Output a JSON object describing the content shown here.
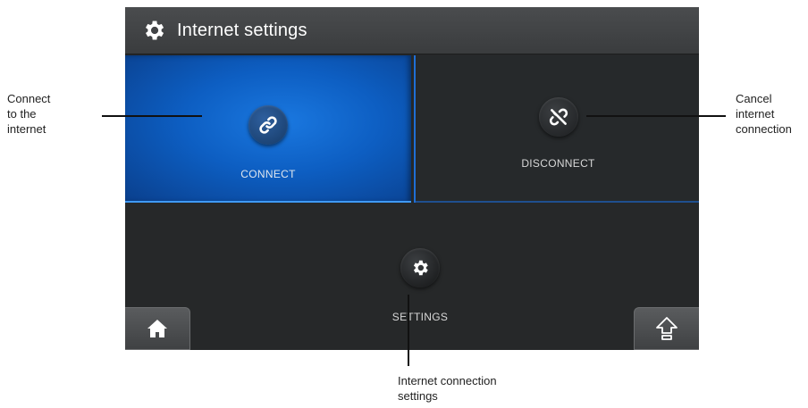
{
  "header": {
    "title": "Internet settings",
    "icon": "gear-icon"
  },
  "tiles": {
    "connect": {
      "label": "CONNECT",
      "icon": "link-icon",
      "accent": "#0d5ec2"
    },
    "disconnect": {
      "label": "DISCONNECT",
      "icon": "broken-link-icon"
    }
  },
  "settings": {
    "label": "SETTINGS",
    "icon": "gear-icon"
  },
  "footer": {
    "home_icon": "home-icon",
    "up_icon": "up-arrow-icon"
  },
  "annotations": {
    "connect_line1": "Connect",
    "connect_line2": "to the",
    "connect_line3": "internet",
    "cancel_line1": "Cancel",
    "cancel_line2": "internet",
    "cancel_line3": "connection",
    "settings_line1": "Internet connection",
    "settings_line2": "settings"
  }
}
